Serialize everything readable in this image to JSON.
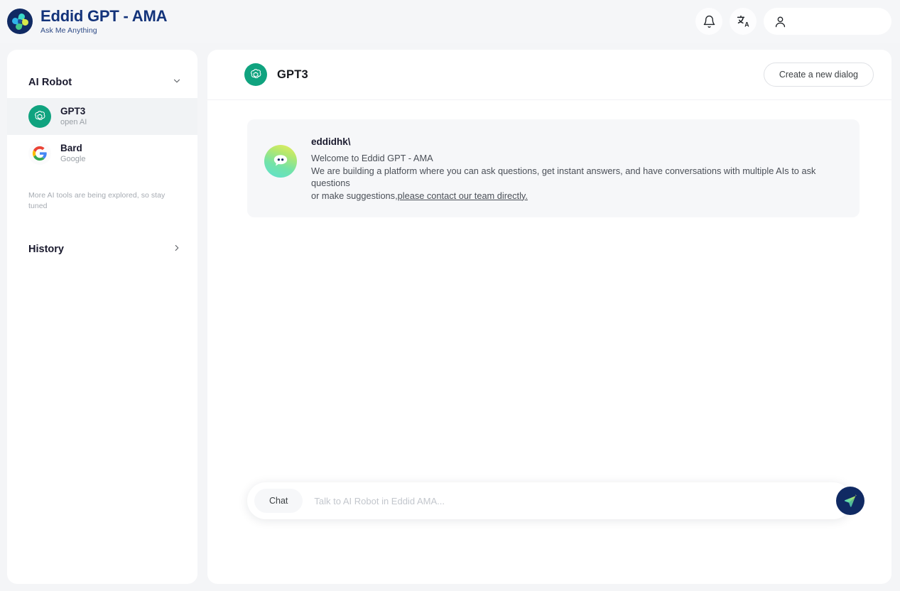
{
  "header": {
    "brand_title": "Eddid GPT - AMA",
    "brand_subtitle": "Ask Me Anything",
    "logo_icon": "eddid-pinwheel-logo",
    "notifications_icon": "bell-icon",
    "translate_icon": "translate-icon",
    "user_icon": "person-icon",
    "user_pill_value": ""
  },
  "sidebar": {
    "section_title": "AI Robot",
    "section_chevron_icon": "chevron-down-icon",
    "bots": [
      {
        "name": "GPT3",
        "provider": "open AI",
        "icon": "openai-logo-icon",
        "active": true
      },
      {
        "name": "Bard",
        "provider": "Google",
        "icon": "google-logo-icon",
        "active": false
      }
    ],
    "note": "More AI tools are being explored, so stay tuned",
    "history_label": "History",
    "history_chevron_icon": "chevron-right-icon"
  },
  "main": {
    "title": "GPT3",
    "title_icon": "openai-logo-icon",
    "new_dialog_label": "Create a new dialog",
    "message": {
      "avatar_icon": "chat-bot-avatar-icon",
      "username": "eddidhk\\",
      "line1": "Welcome to Eddid GPT - AMA",
      "line2": "We are building a platform where you can ask questions, get instant answers, and have conversations with multiple AIs to ask questions",
      "line3_prefix": "or make suggestions,",
      "line3_link": "please contact our team directly."
    },
    "composer": {
      "mode_label": "Chat",
      "placeholder": "Talk to AI Robot in Eddid AMA...",
      "value": "",
      "send_icon": "paper-plane-send-icon"
    }
  },
  "colors": {
    "brand_navy": "#13337a",
    "openai_green": "#10a37f",
    "page_bg": "#f4f5f7",
    "card_bg": "#f6f7f9"
  }
}
